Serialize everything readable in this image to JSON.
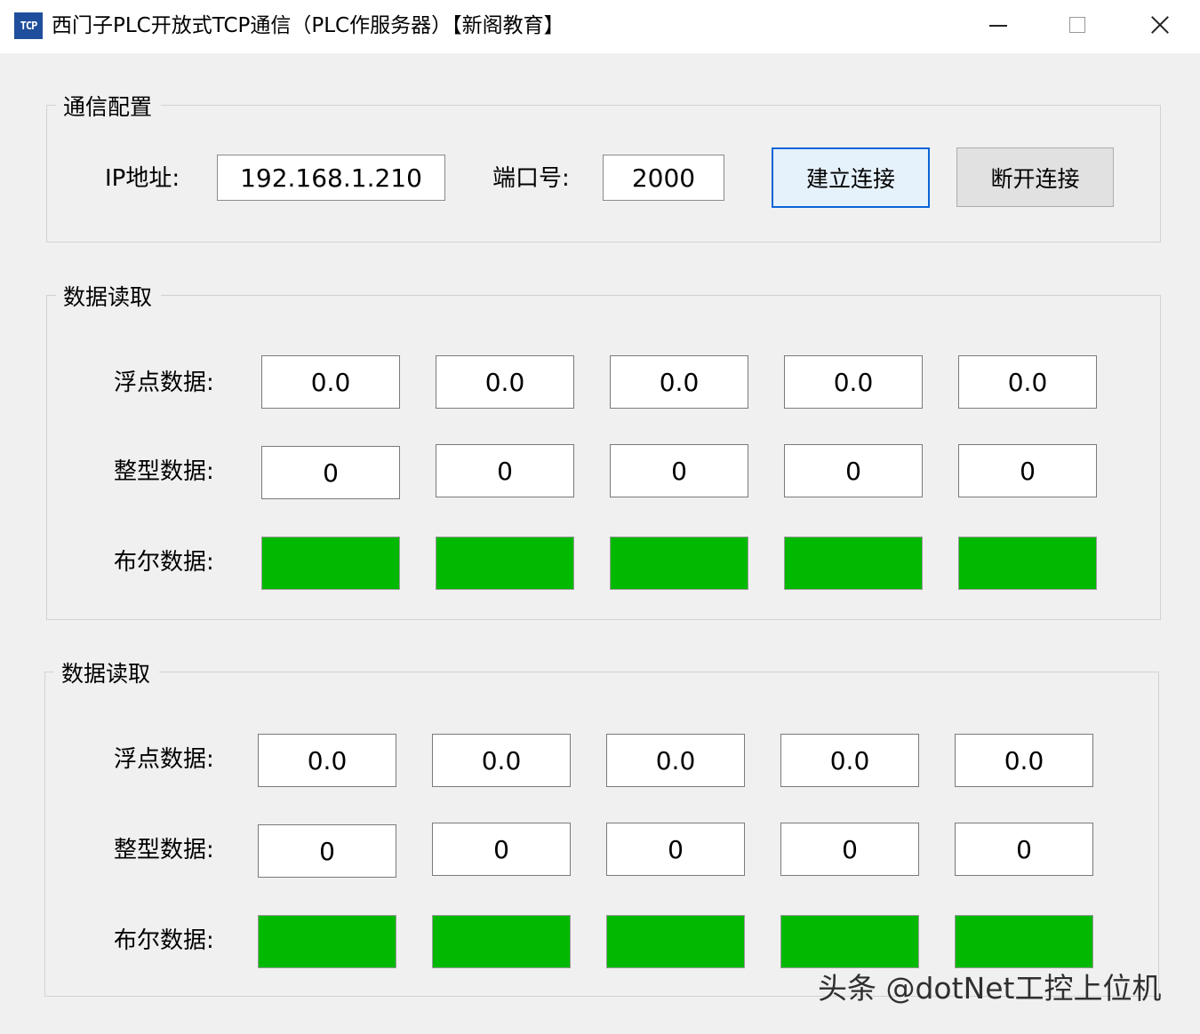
{
  "window": {
    "icon_text": "TCP",
    "title": "西门子PLC开放式TCP通信（PLC作服务器）【新阁教育】"
  },
  "config": {
    "group_title": "通信配置",
    "ip_label": "IP地址:",
    "ip_value": "192.168.1.210",
    "port_label": "端口号:",
    "port_value": "2000",
    "connect_label": "建立连接",
    "disconnect_label": "断开连接"
  },
  "section1": {
    "group_title": "数据读取",
    "float_label": "浮点数据:",
    "int_label": "整型数据:",
    "bool_label": "布尔数据:",
    "floats": [
      "0.0",
      "0.0",
      "0.0",
      "0.0",
      "0.0"
    ],
    "ints": [
      "0",
      "0",
      "0",
      "0",
      "0"
    ],
    "bools": [
      true,
      true,
      true,
      true,
      true
    ]
  },
  "section2": {
    "group_title": "数据读取",
    "float_label": "浮点数据:",
    "int_label": "整型数据:",
    "bool_label": "布尔数据:",
    "floats": [
      "0.0",
      "0.0",
      "0.0",
      "0.0",
      "0.0"
    ],
    "ints": [
      "0",
      "0",
      "0",
      "0",
      "0"
    ],
    "bools": [
      true,
      true,
      true,
      true,
      true
    ]
  },
  "colors": {
    "bool_on": "#00b900",
    "bool_off": "#c8c8c8",
    "accent": "#0a64d8"
  },
  "watermark": "头条 @dotNet工控上位机"
}
